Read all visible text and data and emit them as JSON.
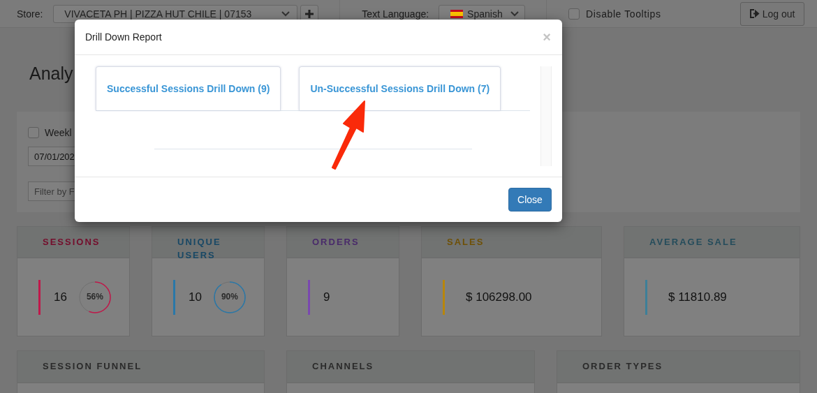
{
  "topbar": {
    "store_label": "Store:",
    "store_value": "VIVACETA PH | PIZZA HUT CHILE | 07153",
    "language_label": "Text Language:",
    "language_value": "Spanish",
    "tooltips": {
      "label": "Disable Tooltips",
      "checked": false
    },
    "logout": "Log out"
  },
  "page": {
    "title": "Analy",
    "weekly": {
      "label": "Weekl",
      "checked": false
    },
    "date_value": "07/01/202",
    "filter_placeholder": "Filter by F"
  },
  "stats": [
    {
      "title": "SESSIONS",
      "color": "#c0184a",
      "value": "16",
      "percent": "56%"
    },
    {
      "title": "UNIQUE USERS",
      "color": "#2a78a8",
      "value": "10",
      "percent": "90%"
    },
    {
      "title": "ORDERS",
      "color": "#7a48b0",
      "value": "9"
    },
    {
      "title": "SALES",
      "color": "#b8860b",
      "value": "$ 106298.00"
    },
    {
      "title": "AVERAGE SALE",
      "color": "#3d7f98",
      "value": "$ 11810.89"
    }
  ],
  "panels": [
    {
      "title": "SESSION FUNNEL"
    },
    {
      "title": "CHANNELS"
    },
    {
      "title": "ORDER TYPES"
    }
  ],
  "modal": {
    "title": "Drill Down Report",
    "close_mark": "×",
    "tabs": [
      {
        "label": "Successful Sessions Drill Down (9)"
      },
      {
        "label": "Un-Successful Sessions Drill Down (7)"
      }
    ],
    "close_button": "Close"
  }
}
